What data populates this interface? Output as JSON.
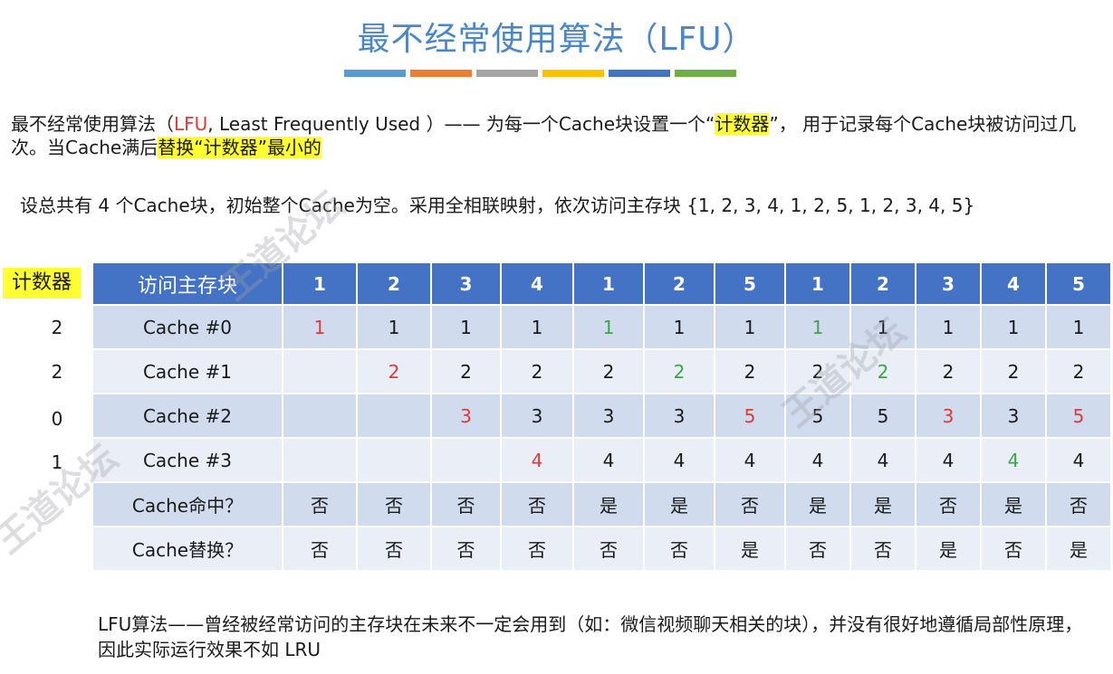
{
  "title": "最不经常使用算法（LFU）",
  "title_colors": [
    "#5b9bd5",
    "#ed7d31",
    "#a5a5a5",
    "#ffc000",
    "#4472c4",
    "#70ad47"
  ],
  "intro": {
    "part1": "最不经常使用算法（",
    "lfu": "LFU",
    "part2": ", Least Frequently Used ）—— 为每一个Cache块设置一个“",
    "highlight1": "计数器",
    "part3": "”， 用于记录每个Cache块被访问过几次。当Cache满后",
    "highlight2": "替换“计数器”最小的"
  },
  "setup_text": "设总共有 4 个Cache块，初始整个Cache为空。采用全相联映射，依次访问主存块 {1, 2, 3, 4, 1, 2, 5, 1, 2, 3, 4, 5}",
  "counter_header": "计数器",
  "counters": [
    "2",
    "2",
    "0",
    "1"
  ],
  "table": {
    "header_label": "访问主存块",
    "accesses": [
      "1",
      "2",
      "3",
      "4",
      "1",
      "2",
      "5",
      "1",
      "2",
      "3",
      "4",
      "5"
    ],
    "rows": [
      {
        "label": "Cache #0",
        "cells": [
          {
            "v": "1",
            "c": "red"
          },
          {
            "v": "1",
            "c": ""
          },
          {
            "v": "1",
            "c": ""
          },
          {
            "v": "1",
            "c": ""
          },
          {
            "v": "1",
            "c": "green"
          },
          {
            "v": "1",
            "c": ""
          },
          {
            "v": "1",
            "c": ""
          },
          {
            "v": "1",
            "c": "green"
          },
          {
            "v": "1",
            "c": ""
          },
          {
            "v": "1",
            "c": ""
          },
          {
            "v": "1",
            "c": ""
          },
          {
            "v": "1",
            "c": ""
          }
        ]
      },
      {
        "label": "Cache #1",
        "cells": [
          {
            "v": "",
            "c": ""
          },
          {
            "v": "2",
            "c": "red"
          },
          {
            "v": "2",
            "c": ""
          },
          {
            "v": "2",
            "c": ""
          },
          {
            "v": "2",
            "c": ""
          },
          {
            "v": "2",
            "c": "green"
          },
          {
            "v": "2",
            "c": ""
          },
          {
            "v": "2",
            "c": ""
          },
          {
            "v": "2",
            "c": "green"
          },
          {
            "v": "2",
            "c": ""
          },
          {
            "v": "2",
            "c": ""
          },
          {
            "v": "2",
            "c": ""
          }
        ]
      },
      {
        "label": "Cache #2",
        "cells": [
          {
            "v": "",
            "c": ""
          },
          {
            "v": "",
            "c": ""
          },
          {
            "v": "3",
            "c": "red"
          },
          {
            "v": "3",
            "c": ""
          },
          {
            "v": "3",
            "c": ""
          },
          {
            "v": "3",
            "c": ""
          },
          {
            "v": "5",
            "c": "red"
          },
          {
            "v": "5",
            "c": ""
          },
          {
            "v": "5",
            "c": ""
          },
          {
            "v": "3",
            "c": "red"
          },
          {
            "v": "3",
            "c": ""
          },
          {
            "v": "5",
            "c": "red"
          }
        ]
      },
      {
        "label": "Cache #3",
        "cells": [
          {
            "v": "",
            "c": ""
          },
          {
            "v": "",
            "c": ""
          },
          {
            "v": "",
            "c": ""
          },
          {
            "v": "4",
            "c": "red"
          },
          {
            "v": "4",
            "c": ""
          },
          {
            "v": "4",
            "c": ""
          },
          {
            "v": "4",
            "c": ""
          },
          {
            "v": "4",
            "c": ""
          },
          {
            "v": "4",
            "c": ""
          },
          {
            "v": "4",
            "c": ""
          },
          {
            "v": "4",
            "c": "green"
          },
          {
            "v": "4",
            "c": ""
          }
        ]
      },
      {
        "label": "Cache命中？",
        "cells": [
          {
            "v": "否",
            "c": ""
          },
          {
            "v": "否",
            "c": ""
          },
          {
            "v": "否",
            "c": ""
          },
          {
            "v": "否",
            "c": ""
          },
          {
            "v": "是",
            "c": ""
          },
          {
            "v": "是",
            "c": ""
          },
          {
            "v": "否",
            "c": ""
          },
          {
            "v": "是",
            "c": ""
          },
          {
            "v": "是",
            "c": ""
          },
          {
            "v": "否",
            "c": ""
          },
          {
            "v": "是",
            "c": ""
          },
          {
            "v": "否",
            "c": ""
          }
        ]
      },
      {
        "label": "Cache替换？",
        "cells": [
          {
            "v": "否",
            "c": ""
          },
          {
            "v": "否",
            "c": ""
          },
          {
            "v": "否",
            "c": ""
          },
          {
            "v": "否",
            "c": ""
          },
          {
            "v": "否",
            "c": ""
          },
          {
            "v": "否",
            "c": ""
          },
          {
            "v": "是",
            "c": ""
          },
          {
            "v": "否",
            "c": ""
          },
          {
            "v": "否",
            "c": ""
          },
          {
            "v": "是",
            "c": ""
          },
          {
            "v": "否",
            "c": ""
          },
          {
            "v": "是",
            "c": ""
          }
        ]
      }
    ]
  },
  "bottom_note": "LFU算法——曾经被经常访问的主存块在未来不一定会用到（如：微信视频聊天相关的块），并没有很好地遵循局部性原理，因此实际运行效果不如 LRU",
  "watermark_text": "王道论坛",
  "colors": {
    "accent": "#4472c4",
    "title": "#4a86c8",
    "highlight": "#ffff33",
    "red": "#e63737",
    "green": "#3aa648"
  }
}
